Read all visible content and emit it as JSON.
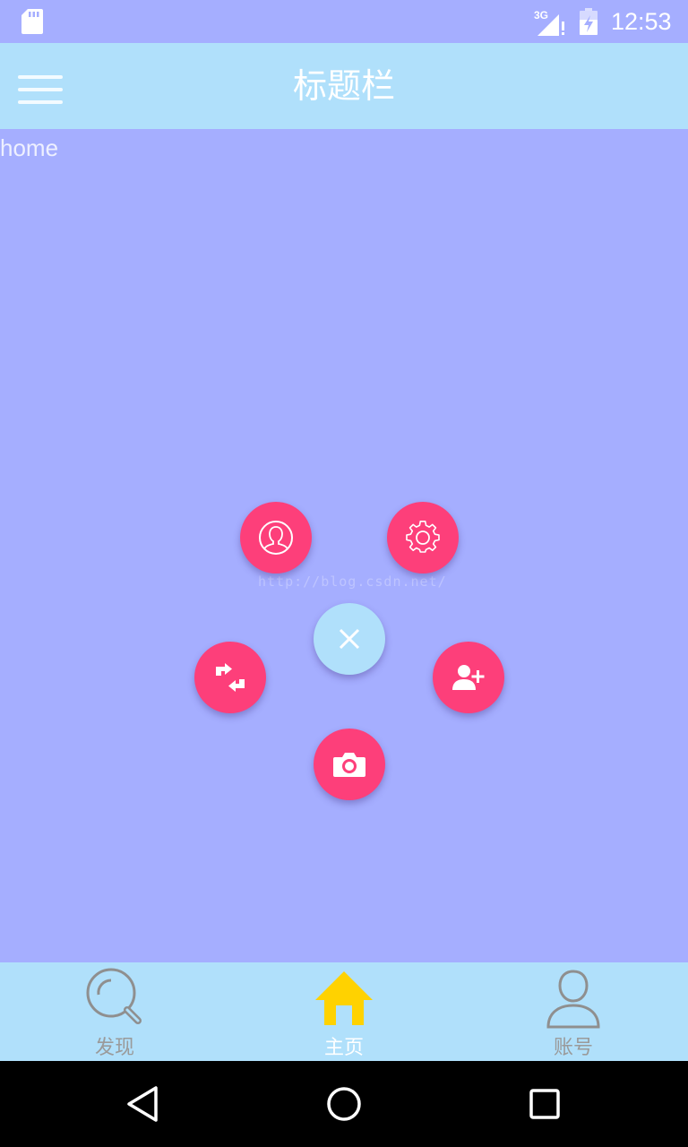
{
  "status_bar": {
    "time": "12:53",
    "network_label": "3G",
    "icons": [
      "sd-card-icon",
      "signal-3g-icon",
      "battery-icon"
    ]
  },
  "title_bar": {
    "title": "标题栏",
    "menu_icon": "hamburger-menu-icon"
  },
  "content": {
    "label": "home",
    "watermark": "http://blog.csdn.net/"
  },
  "fab_menu": {
    "close_icon": "close-icon",
    "items": [
      {
        "icon": "user-profile-icon"
      },
      {
        "icon": "settings-gear-icon"
      },
      {
        "icon": "swap-arrows-icon"
      },
      {
        "icon": "add-user-icon"
      },
      {
        "icon": "camera-icon"
      }
    ]
  },
  "bottom_nav": {
    "items": [
      {
        "label": "发现",
        "icon": "search-icon",
        "active": false
      },
      {
        "label": "主页",
        "icon": "home-icon",
        "active": true
      },
      {
        "label": "账号",
        "icon": "user-icon",
        "active": false
      }
    ]
  },
  "system_nav": {
    "buttons": [
      "back-icon",
      "home-circle-icon",
      "recents-icon"
    ]
  },
  "colors": {
    "background": "#a5aeff",
    "bars": "#b0e0fb",
    "fab": "#fd3f7a",
    "active_nav": "#ffd200"
  }
}
